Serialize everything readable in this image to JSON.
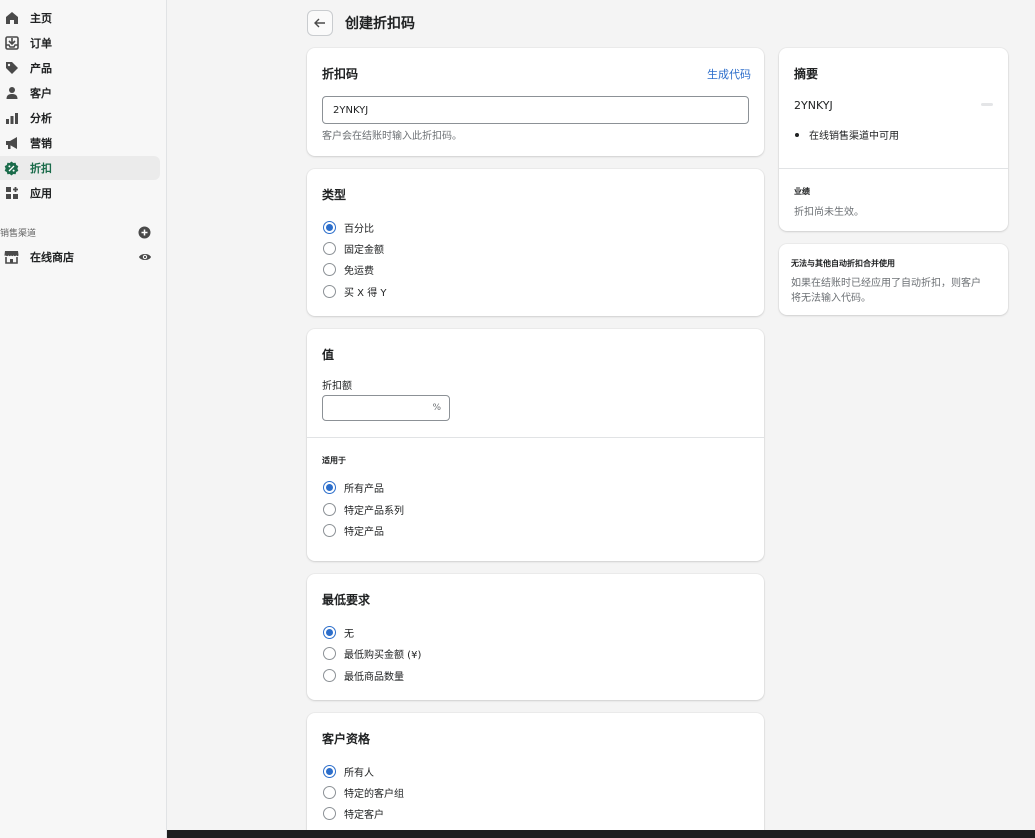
{
  "sidebar": {
    "items": [
      {
        "label": "主页",
        "icon": "home-icon"
      },
      {
        "label": "订单",
        "icon": "inbox-icon"
      },
      {
        "label": "产品",
        "icon": "tag-icon"
      },
      {
        "label": "客户",
        "icon": "person-icon"
      },
      {
        "label": "分析",
        "icon": "bar-chart-icon"
      },
      {
        "label": "营销",
        "icon": "megaphone-icon"
      },
      {
        "label": "折扣",
        "icon": "discount-icon",
        "active": true
      },
      {
        "label": "应用",
        "icon": "apps-icon"
      }
    ],
    "sales_channels_label": "销售渠道",
    "online_store_label": "在线商店"
  },
  "header": {
    "title": "创建折扣码"
  },
  "code_card": {
    "title": "折扣码",
    "generate_link": "生成代码",
    "value": "2YNKYJ",
    "help": "客户会在结账时输入此折扣码。"
  },
  "type_card": {
    "title": "类型",
    "options": [
      "百分比",
      "固定金额",
      "免运费",
      "买 X 得 Y"
    ],
    "selected": 0
  },
  "value_card": {
    "title": "值",
    "amount_label": "折扣额",
    "amount_value": "",
    "suffix": "%",
    "applies_label": "适用于",
    "applies_options": [
      "所有产品",
      "特定产品系列",
      "特定产品"
    ],
    "applies_selected": 0
  },
  "min_card": {
    "title": "最低要求",
    "options": [
      "无",
      "最低购买金额 (¥)",
      "最低商品数量"
    ],
    "selected": 0
  },
  "customer_card": {
    "title": "客户资格",
    "options": [
      "所有人",
      "特定的客户组",
      "特定客户"
    ],
    "selected": 0
  },
  "summary_card": {
    "title": "摘要",
    "code": "2YNKYJ",
    "bullet": "在线销售渠道中可用",
    "performance_label": "业绩",
    "performance_text": "折扣尚未生效。"
  },
  "combine_card": {
    "title": "无法与其他自动折扣合并使用",
    "text_line1": "如果在结账时已经应用了自动折扣，则客户",
    "text_line2": "将无法输入代码。"
  },
  "colors": {
    "accent": "#2c6ecb",
    "active_nav": "#1a6b4a"
  }
}
